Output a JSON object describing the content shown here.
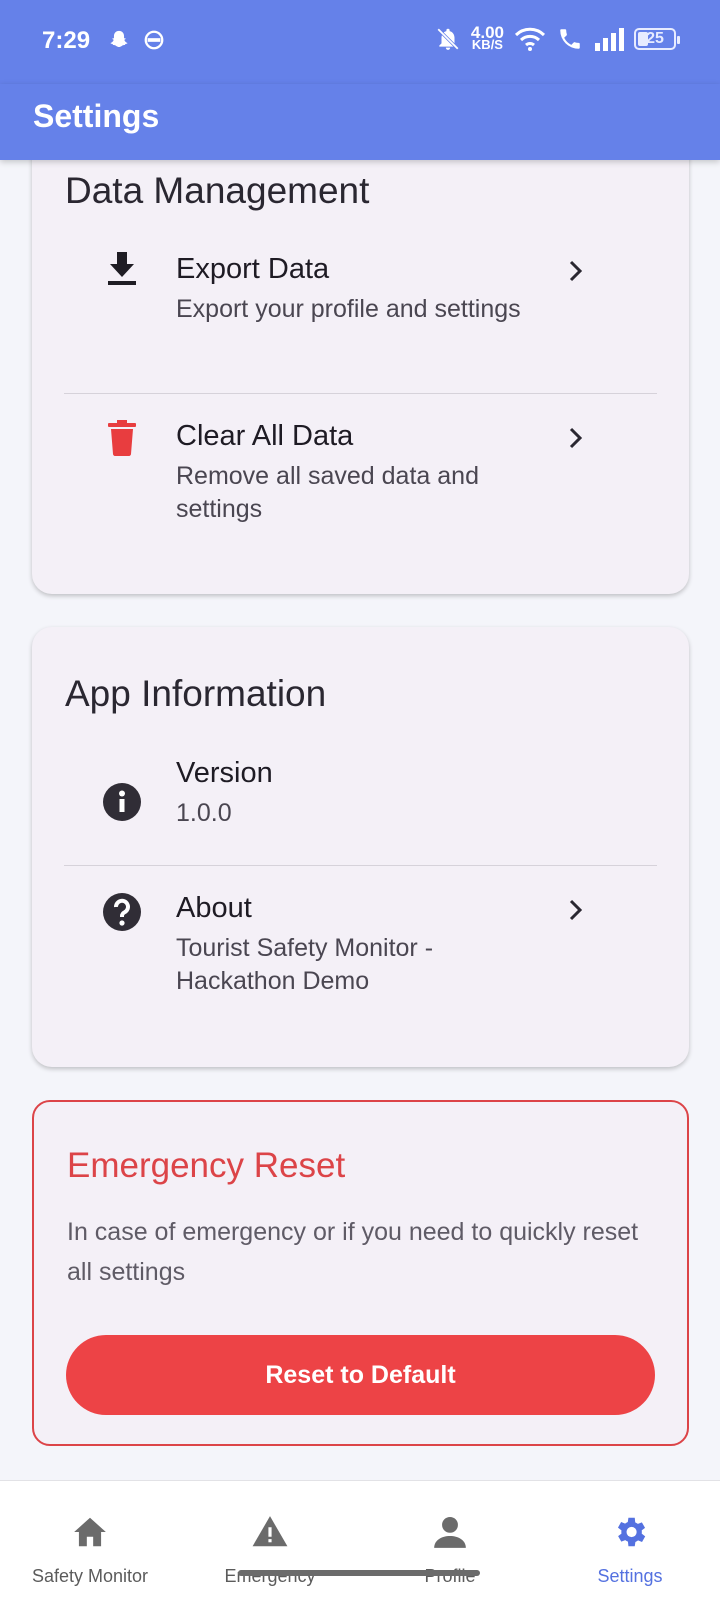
{
  "status_bar": {
    "time": "7:29",
    "net_speed_value": "4.00",
    "net_speed_unit": "KB/S",
    "battery": "25"
  },
  "app_bar": {
    "title": "Settings"
  },
  "data_management": {
    "title": "Data Management",
    "items": [
      {
        "title": "Export Data",
        "subtitle": "Export your profile and settings",
        "icon": "download-icon"
      },
      {
        "title": "Clear All Data",
        "subtitle": "Remove all saved data and settings",
        "icon": "trash-icon"
      }
    ]
  },
  "app_information": {
    "title": "App Information",
    "items": [
      {
        "title": "Version",
        "subtitle": "1.0.0",
        "icon": "info-icon"
      },
      {
        "title": "About",
        "subtitle": "Tourist Safety Monitor - Hackathon Demo",
        "icon": "help-icon"
      }
    ]
  },
  "emergency_reset": {
    "title": "Emergency Reset",
    "description": "In case of emergency or if you need to quickly reset all settings",
    "button_label": "Reset to Default"
  },
  "bottom_nav": {
    "items": [
      {
        "label": "Safety Monitor",
        "icon": "home-icon"
      },
      {
        "label": "Emergency",
        "icon": "warning-icon"
      },
      {
        "label": "Profile",
        "icon": "person-icon"
      },
      {
        "label": "Settings",
        "icon": "gear-icon"
      }
    ],
    "active": "Settings"
  },
  "colors": {
    "primary": "#6581e9",
    "danger": "#ed4346",
    "danger_text": "#dc4448",
    "active_nav": "#5471e0",
    "card_bg": "#f4f0f7"
  }
}
